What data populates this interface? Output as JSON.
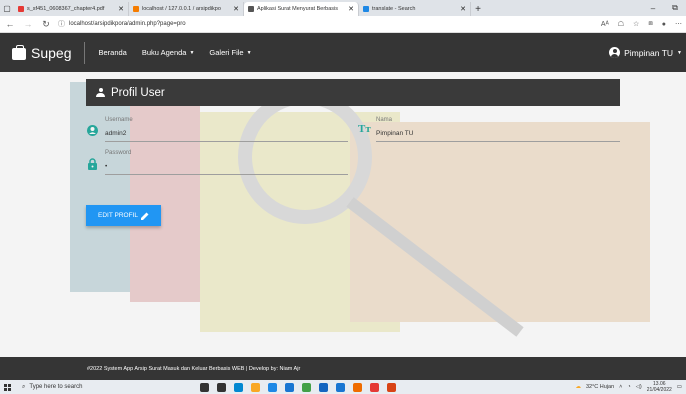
{
  "browser": {
    "tabs": [
      {
        "title": "s_sf451_0608367_chapter4.pdf",
        "fav": "#e53935"
      },
      {
        "title": "localhost / 127.0.0.1 / arsipdikpo",
        "fav": "#f57c00"
      },
      {
        "title": "Aplikasi Surat Menyurat Berbasis",
        "fav": "#555555"
      },
      {
        "title": "translate - Search",
        "fav": "#1e88e5"
      }
    ],
    "new_tab": "+",
    "url": "localhost/arsipdikpora/admin.php?page=pro",
    "read_aloud": "Aᴬ"
  },
  "navbar": {
    "brand": "Supeg",
    "menu": [
      {
        "label": "Beranda",
        "caret": ""
      },
      {
        "label": "Buku Agenda",
        "caret": "▼"
      },
      {
        "label": "Galeri File",
        "caret": "▼"
      }
    ],
    "user_label": "Pimpinan TU",
    "user_caret": "▼"
  },
  "card": {
    "title": "Profil User"
  },
  "form": {
    "username_label": "Username",
    "username_value": "admin2",
    "nama_label": "Nama",
    "nama_value": "Pimpinan TU",
    "password_label": "Password",
    "password_value": "•",
    "edit_button": "EDIT PROFIL"
  },
  "footer": {
    "text": "#2022 System App Arsip Surat Masuk dan Keluar Berbasis WEB | Develop by: Niam Ajr"
  },
  "taskbar": {
    "search_placeholder": "Type here to search",
    "weather": "32°C  Hujan",
    "time": "13.06",
    "date": "21/04/2022",
    "icon_colors": [
      "#333333",
      "#333333",
      "#0288d1",
      "#f9a825",
      "#1e88e5",
      "#1976d2",
      "#43a047",
      "#1565c0",
      "#1976d2",
      "#ef6c00",
      "#e53935",
      "#d84315"
    ]
  }
}
